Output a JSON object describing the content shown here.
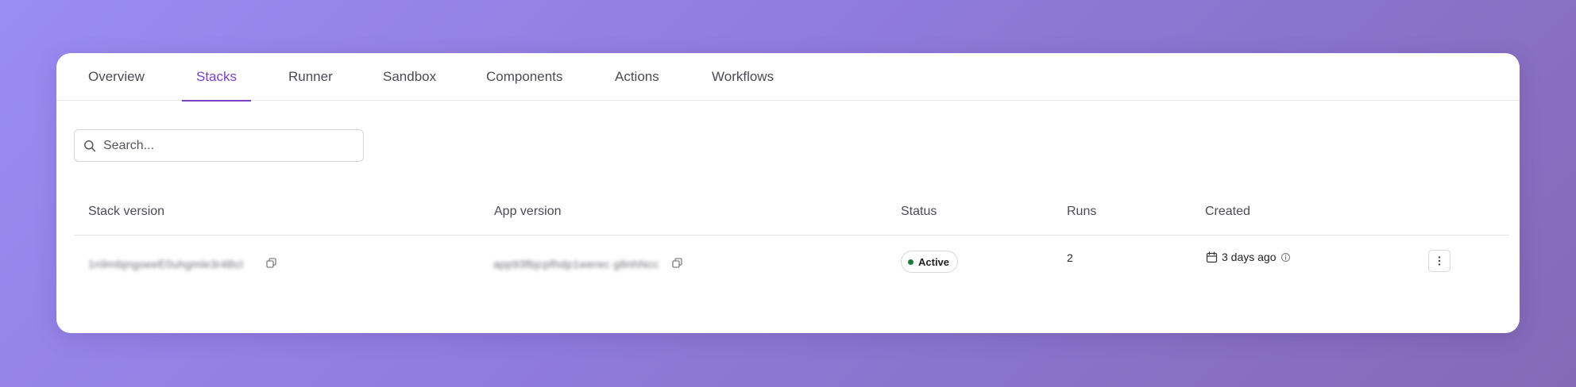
{
  "tabs": [
    {
      "label": "Overview",
      "active": false
    },
    {
      "label": "Stacks",
      "active": true
    },
    {
      "label": "Runner",
      "active": false
    },
    {
      "label": "Sandbox",
      "active": false
    },
    {
      "label": "Components",
      "active": false
    },
    {
      "label": "Actions",
      "active": false
    },
    {
      "label": "Workflows",
      "active": false
    }
  ],
  "search": {
    "placeholder": "Search...",
    "value": ""
  },
  "table": {
    "columns": [
      "Stack version",
      "App version",
      "Status",
      "Runs",
      "Created"
    ],
    "rows": [
      {
        "stack_version": "1n9mbjngoeeE0uhgmle3r4Bcl",
        "app_version": "app93fbjcpfhdp1werec g8nhNcc",
        "status": "Active",
        "runs": "2",
        "created": "3 days ago"
      }
    ]
  },
  "colors": {
    "accent": "#7b3fc4",
    "status_active": "#1f7a3a",
    "background_start": "#9b8cf2",
    "background_end": "#8469b6"
  },
  "icons": {
    "search": "search-icon",
    "copy": "copy-icon",
    "calendar": "calendar-icon",
    "info": "info-icon",
    "more": "more-vertical-icon"
  }
}
